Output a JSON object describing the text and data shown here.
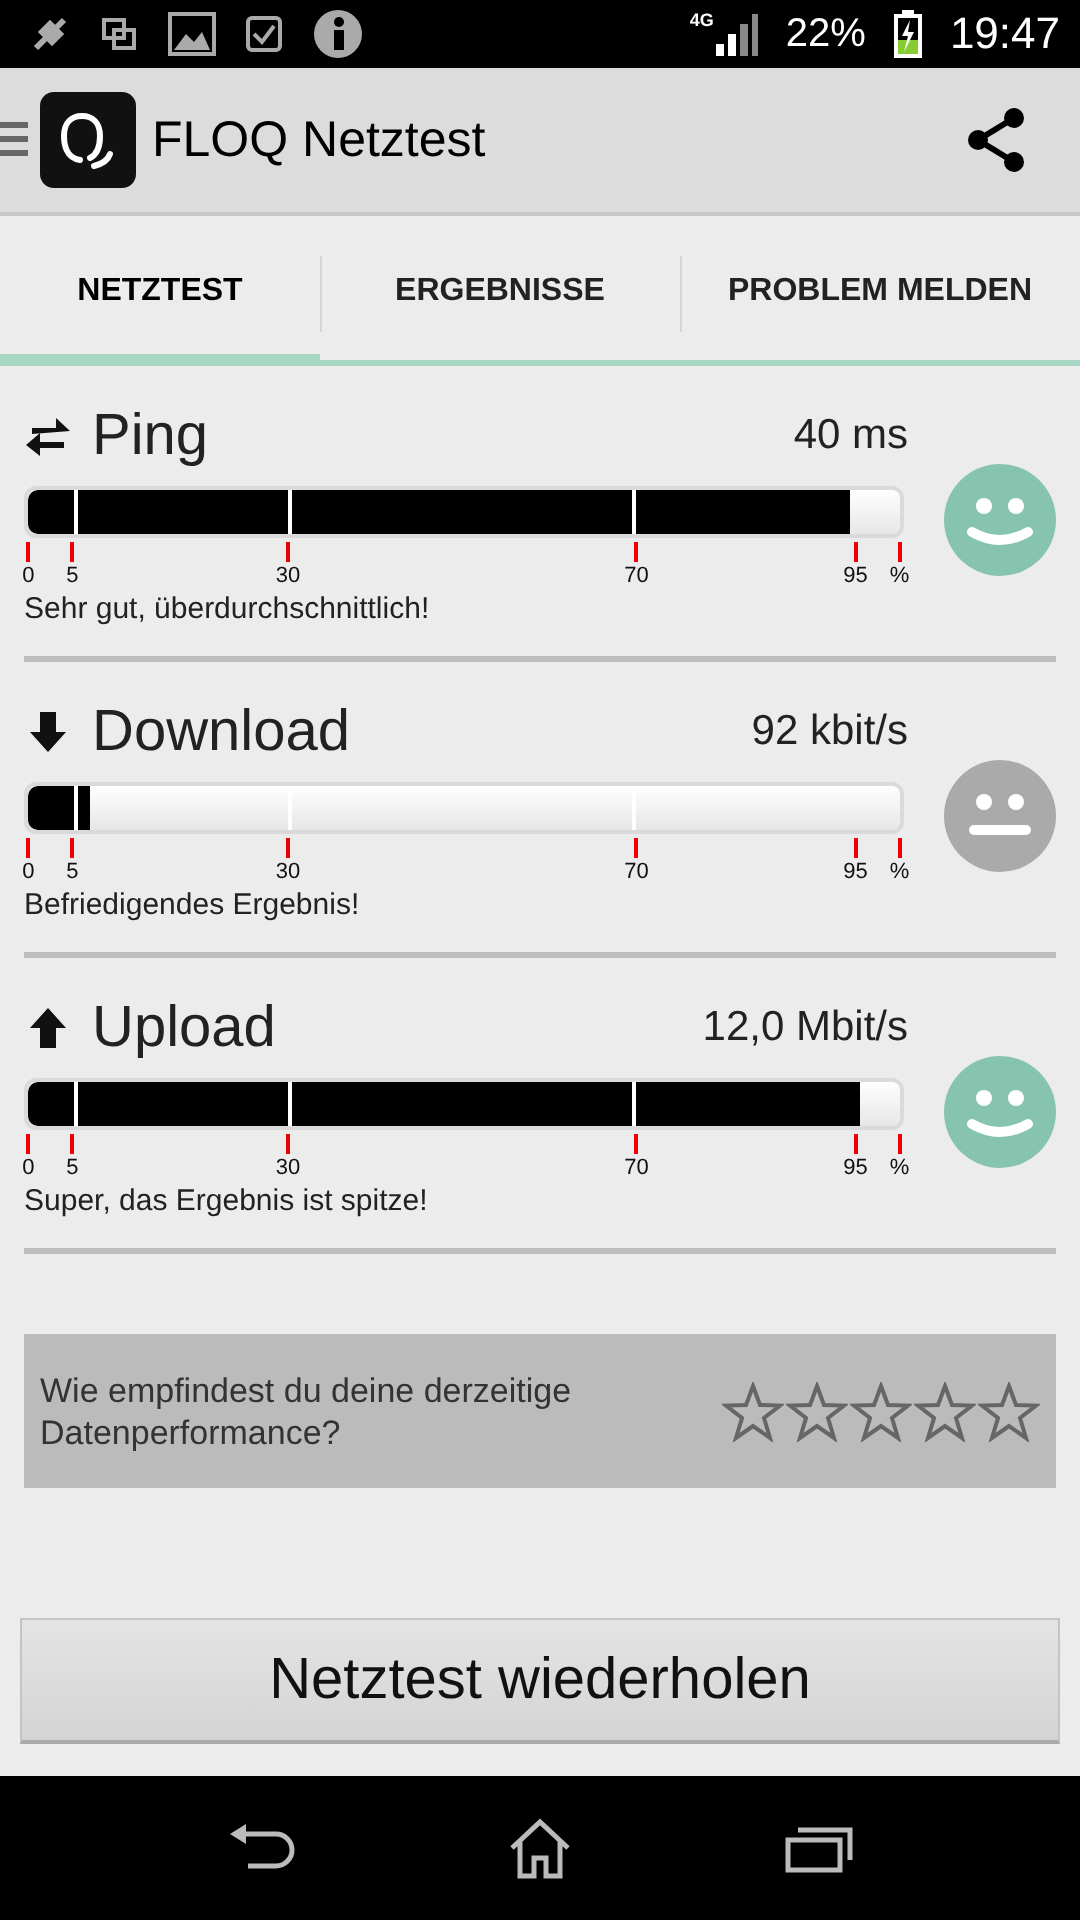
{
  "status_bar": {
    "network": "4G",
    "battery": "22%",
    "time": "19:47"
  },
  "app_bar": {
    "title": "FLOQ Netztest"
  },
  "tabs": [
    {
      "label": "NETZTEST",
      "selected": true
    },
    {
      "label": "ERGEBNISSE",
      "selected": false
    },
    {
      "label": "PROBLEM MELDEN",
      "selected": false
    }
  ],
  "metrics": [
    {
      "kind": "ping",
      "name": "Ping",
      "value": "40 ms",
      "level": 0.943,
      "face": {
        "kind": "smile",
        "color": "#86c4b0"
      },
      "scale": [
        "0",
        "5",
        "30",
        "70",
        "95",
        "%"
      ],
      "verdict": "Sehr gut, überdurchschnittlich!"
    },
    {
      "kind": "download",
      "name": "Download",
      "value": "92 kbit/s",
      "level": 0.07,
      "face": {
        "kind": "neutral",
        "color": "#aaaaaa"
      },
      "scale": [
        "0",
        "5",
        "30",
        "70",
        "95",
        "%"
      ],
      "verdict": "Befriedigendes Ergebnis!"
    },
    {
      "kind": "upload",
      "name": "Upload",
      "value": "12,0 Mbit/s",
      "level": 0.955,
      "face": {
        "kind": "smile",
        "color": "#86c4b0"
      },
      "scale": [
        "0",
        "5",
        "30",
        "70",
        "95",
        "%"
      ],
      "verdict": "Super, das Ergebnis ist spitze!"
    }
  ],
  "rating": {
    "question": "Wie empfindest du deine derzeitige Datenperformance?",
    "stars": 0
  },
  "action_button": {
    "label": "Netztest wiederholen"
  }
}
